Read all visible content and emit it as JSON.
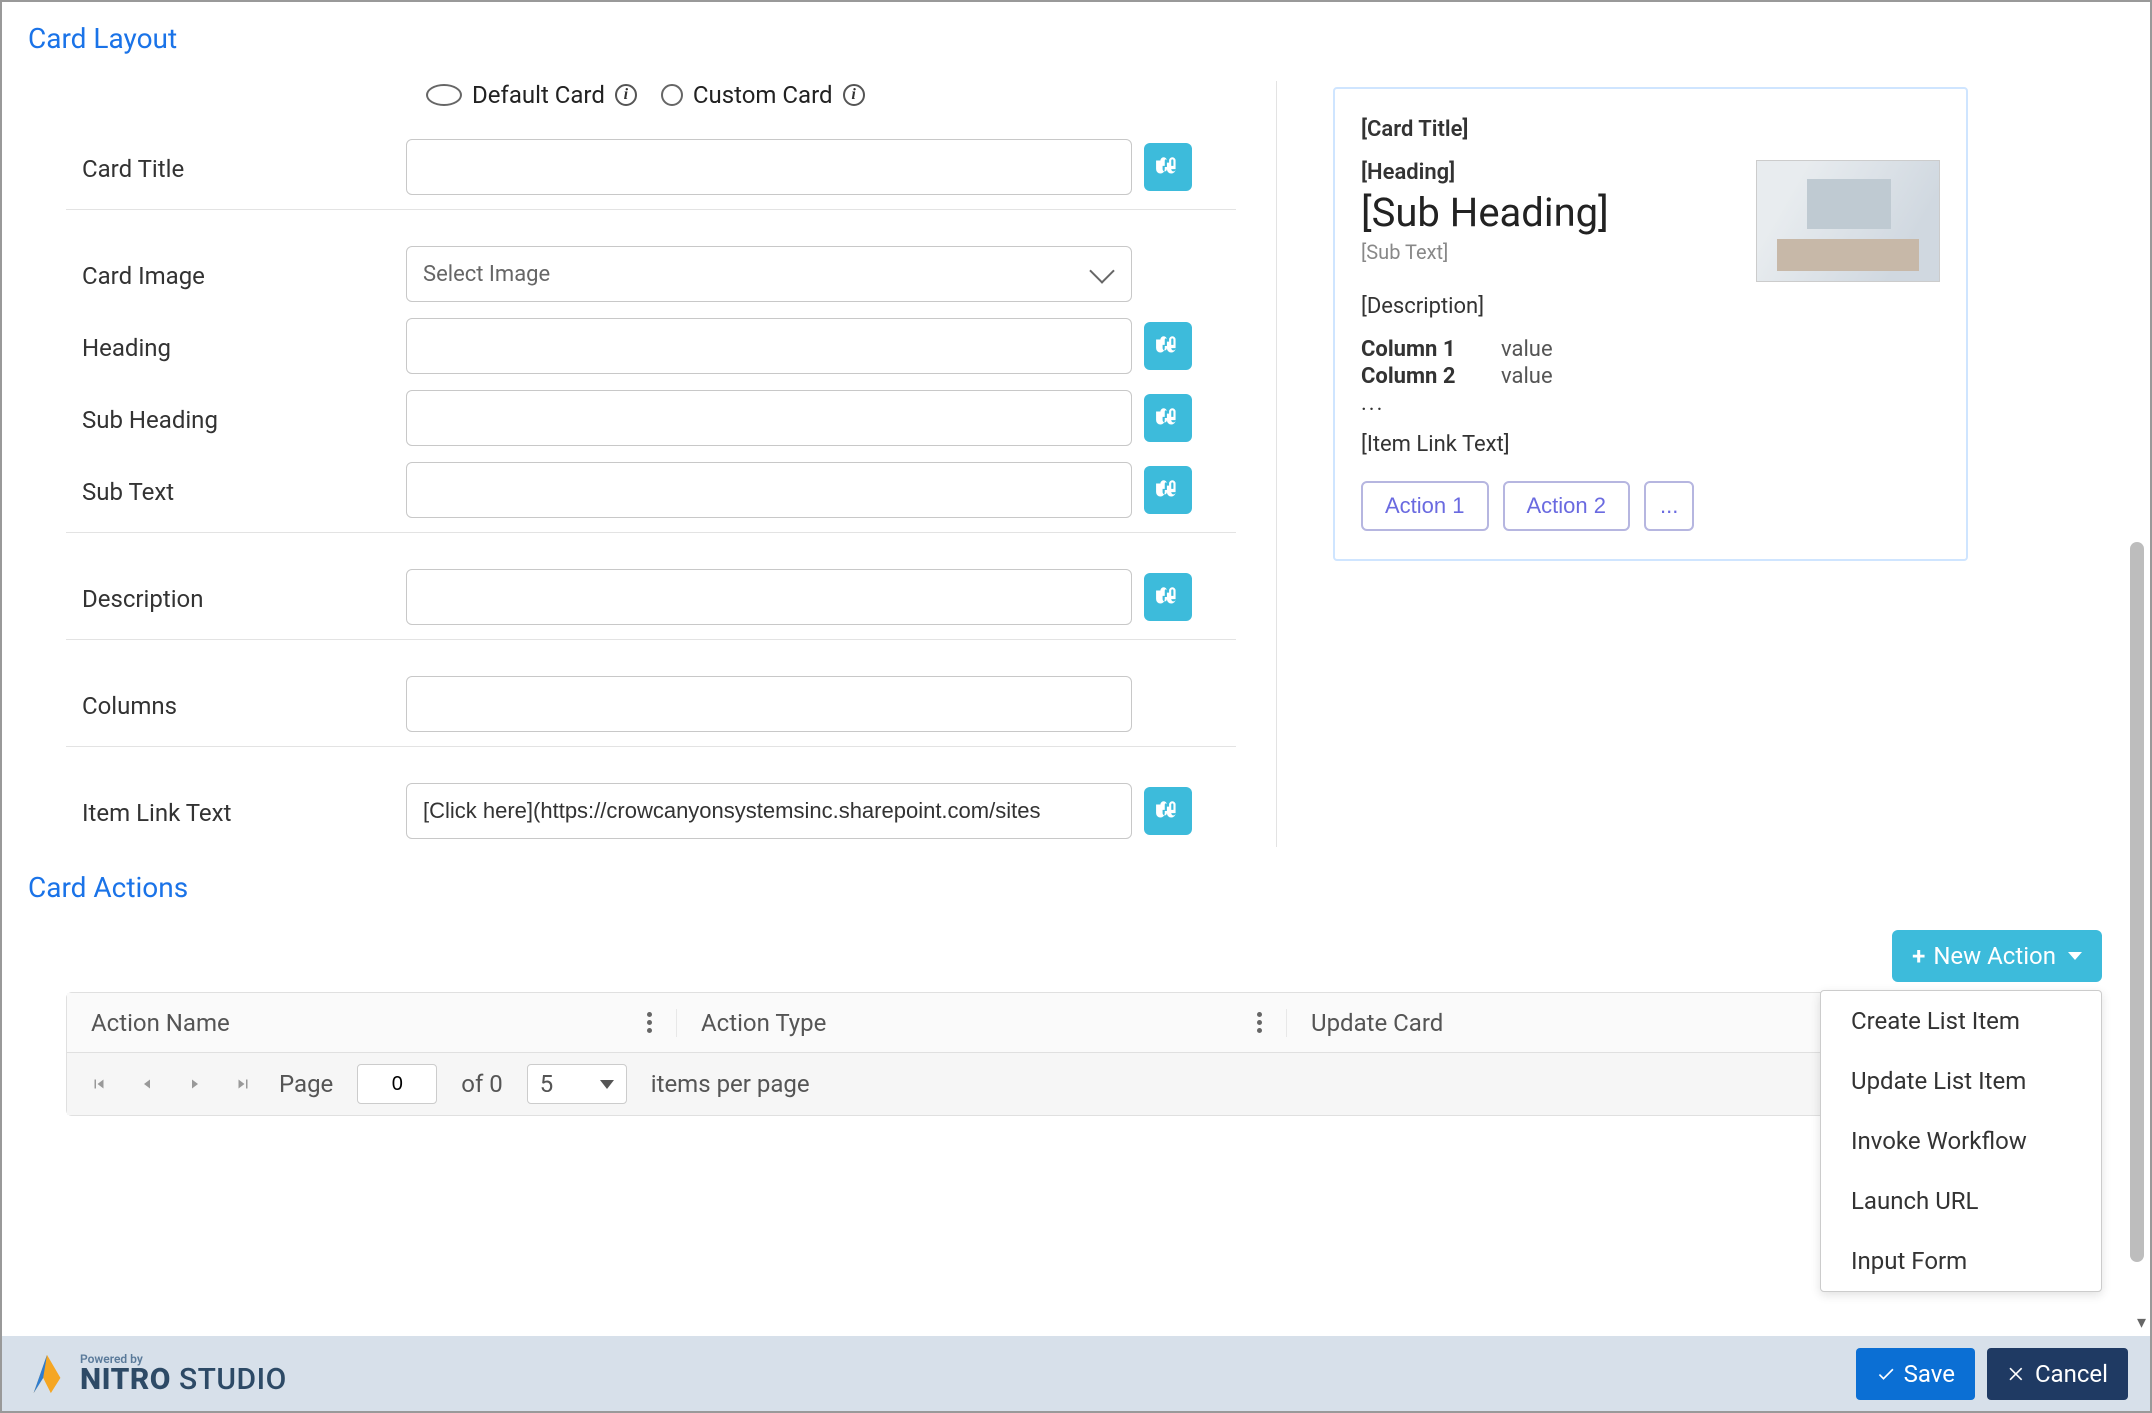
{
  "sections": {
    "card_layout_title": "Card Layout",
    "card_actions_title": "Card Actions"
  },
  "cardLayout": {
    "radios": {
      "default": "Default Card",
      "custom": "Custom Card",
      "selected": "default"
    },
    "labels": {
      "card_title": "Card Title",
      "card_image": "Card Image",
      "heading": "Heading",
      "sub_heading": "Sub Heading",
      "sub_text": "Sub Text",
      "description": "Description",
      "columns": "Columns",
      "item_link_text": "Item Link Text"
    },
    "values": {
      "card_title": "",
      "card_image_placeholder": "Select Image",
      "heading": "",
      "sub_heading": "",
      "sub_text": "",
      "description": "",
      "columns": "",
      "item_link_text": "[Click here](https://crowcanyonsystemsinc.sharepoint.com/sites"
    }
  },
  "preview": {
    "title": "[Card Title]",
    "heading": "[Heading]",
    "subheading": "[Sub Heading]",
    "subtext": "[Sub Text]",
    "description": "[Description]",
    "cols": [
      {
        "k": "Column 1",
        "v": "value"
      },
      {
        "k": "Column 2",
        "v": "value"
      }
    ],
    "dots": "...",
    "item_link": "[Item Link Text]",
    "actions": [
      "Action 1",
      "Action 2",
      "..."
    ]
  },
  "cardActions": {
    "new_action_label": "New Action",
    "menu": [
      "Create List Item",
      "Update List Item",
      "Invoke Workflow",
      "Launch URL",
      "Input Form"
    ],
    "headers": {
      "name": "Action Name",
      "type": "Action Type",
      "update": "Update Card"
    },
    "pager": {
      "page_label": "Page",
      "page_value": "0",
      "of_text": "of 0",
      "page_size": "5",
      "ipp": "items per page"
    }
  },
  "footer": {
    "powered_by": "Powered by",
    "brand_bold": "NITRO",
    "brand_rest": " STUDIO",
    "save": "Save",
    "cancel": "Cancel"
  }
}
